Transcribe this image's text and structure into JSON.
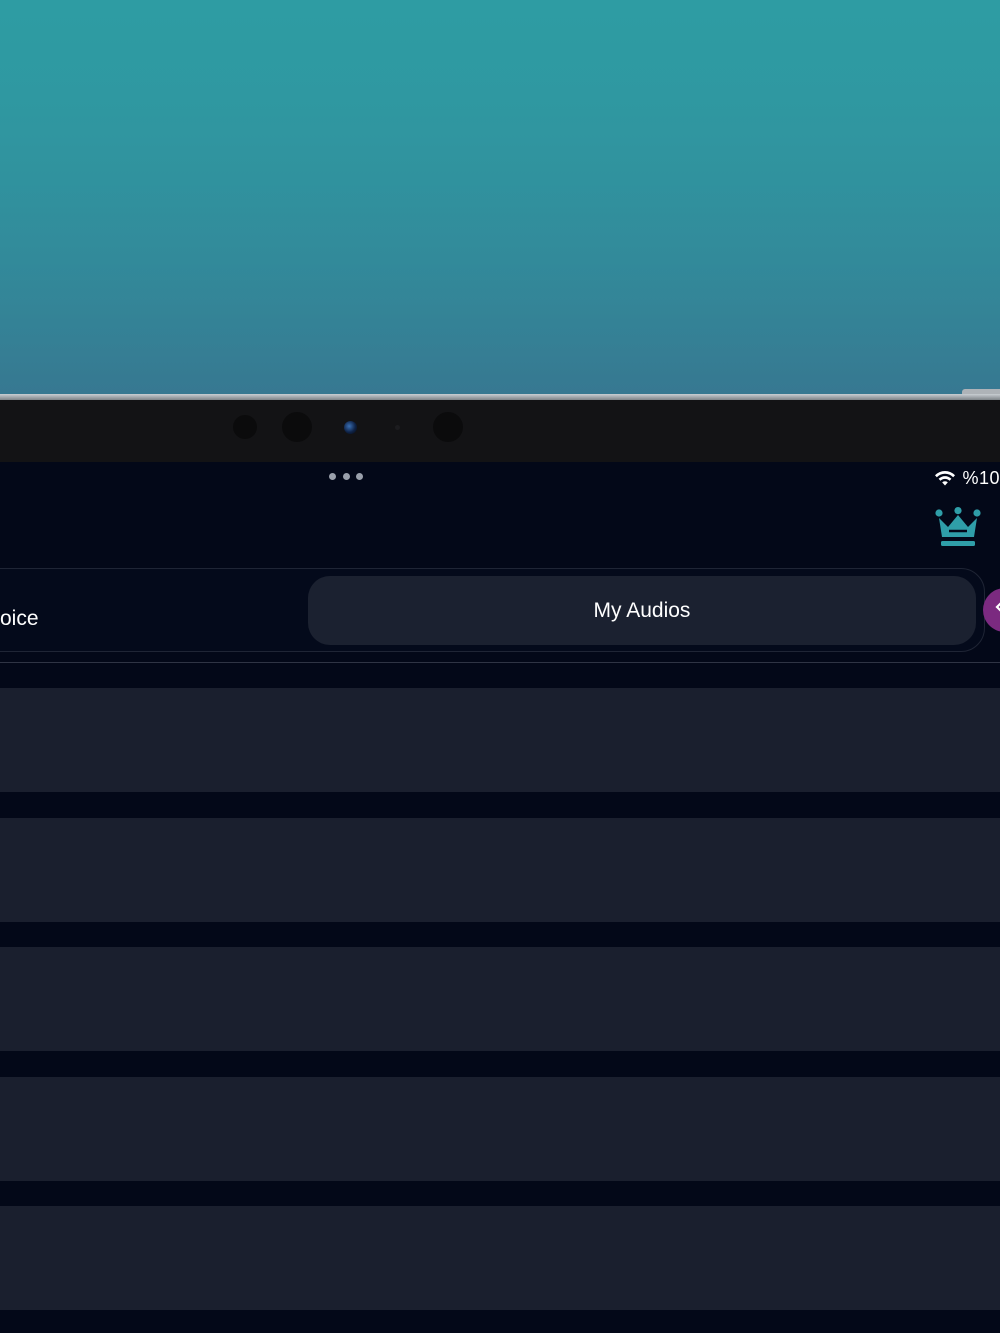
{
  "status_bar": {
    "battery": "%10"
  },
  "tabs": {
    "left_label": "oice",
    "active_label": "My Audios"
  },
  "icons": {
    "multitask": "more-dots-icon",
    "wifi": "wifi-icon",
    "crown": "crown-icon",
    "fab": "arrow-left-icon"
  },
  "colors": {
    "background": "#030818",
    "accent": "#2f9ea8",
    "row": "#1a1f2e",
    "active_tab": "#1b2130",
    "fab": "#7b2a80"
  },
  "list": {
    "items": [
      {
        "label": ""
      },
      {
        "label": ""
      },
      {
        "label": ""
      },
      {
        "label": ""
      },
      {
        "label": ""
      }
    ]
  }
}
